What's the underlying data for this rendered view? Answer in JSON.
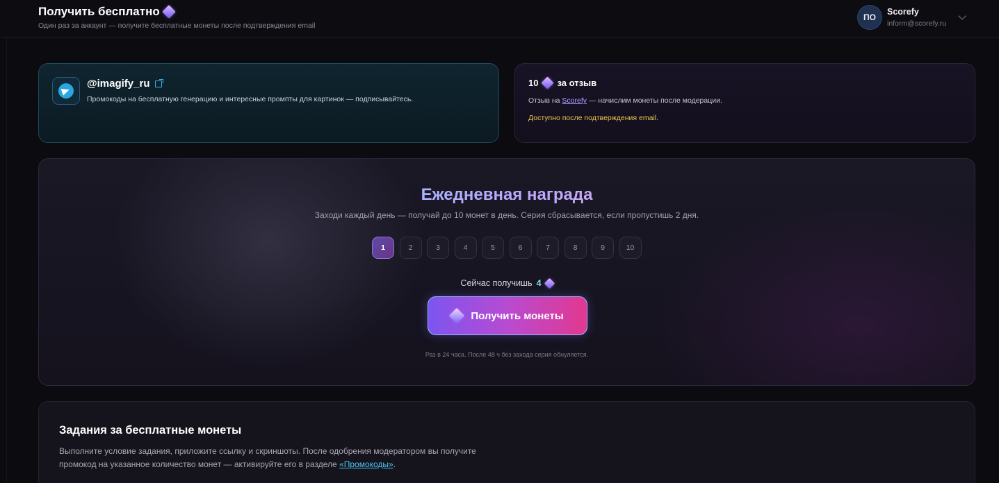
{
  "header": {
    "title": "Получить бесплатно",
    "subtitle": "Один раз за аккаунт — получите бесплатные монеты после подтверждения email",
    "gem_icon": "diamond-icon"
  },
  "user": {
    "initials": "ПО",
    "name": "Scorefy",
    "email": "inform@scorefy.ru"
  },
  "telegram": {
    "handle": "@imagify_ru",
    "description": "Промокоды на бесплатную генерацию и интересные промпты для картинок — подписывайтесь."
  },
  "review": {
    "amount": "10",
    "title_suffix": "за отзыв",
    "desc_prefix": "Отзыв на",
    "desc_link": "Scorefy",
    "desc_suffix": "— начислим монеты после модерации.",
    "note": "Доступно после подтверждения email."
  },
  "daily": {
    "title": "Ежедневная награда",
    "subtitle": "Заходи каждый день — получай до 10 монет в день. Серия сбрасывается, если пропустишь 2 дня.",
    "days": [
      "1",
      "2",
      "3",
      "4",
      "5",
      "6",
      "7",
      "8",
      "9",
      "10"
    ],
    "active_day": 1,
    "now_label": "Сейчас получишь",
    "now_value": "4",
    "button_label": "Получить монеты",
    "note": "Раз в 24 часа. После 48 ч без захода серия обнуляется."
  },
  "tasks": {
    "title": "Задания за бесплатные монеты",
    "desc_1": "Выполните условие задания, приложите ссылку и скриншоты. После одобрения модератором вы получите промокод на указанное количество монет — активируйте его в разделе",
    "desc_link": "«Промокоды»",
    "desc_end": "."
  },
  "colors": {
    "background": "#0c0b10",
    "accent_purple": "#7c55f0",
    "accent_pink": "#e2388f",
    "telegram_blue": "#2aa6e0",
    "warning_yellow": "#e8c64a"
  }
}
